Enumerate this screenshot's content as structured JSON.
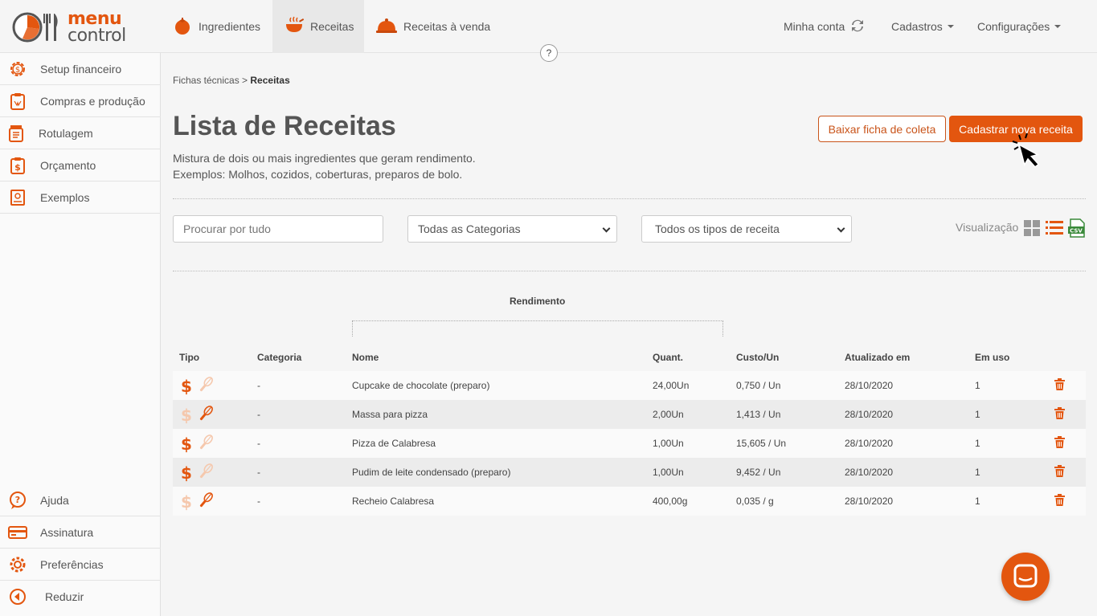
{
  "app": {
    "logo_line1": "menu",
    "logo_line2": "control"
  },
  "colors": {
    "accent": "#e3560f",
    "accent_light": "#f5c8ad",
    "text": "#444444"
  },
  "topnav": {
    "items": [
      {
        "label": "Ingredientes",
        "icon": "tomato-icon"
      },
      {
        "label": "Receitas",
        "icon": "steaming-pot-icon",
        "active": true
      },
      {
        "label": "Receitas à venda",
        "icon": "cloche-icon"
      }
    ],
    "right": {
      "account": "Minha conta",
      "cadastros": "Cadastros",
      "config": "Configurações"
    },
    "help": "?"
  },
  "sidebar": {
    "items": [
      {
        "label": "Setup financeiro",
        "icon": "gear-dollar-icon"
      },
      {
        "label": "Compras e produção",
        "icon": "clipboard-icon"
      },
      {
        "label": "Rotulagem",
        "icon": "jar-label-icon"
      },
      {
        "label": "Orçamento",
        "icon": "clipboard-dollar-icon"
      },
      {
        "label": "Exemplos",
        "icon": "book-icon"
      }
    ],
    "bottom": [
      {
        "label": "Ajuda",
        "icon": "question-bubble-icon"
      },
      {
        "label": "Assinatura",
        "icon": "credit-card-icon"
      },
      {
        "label": "Preferências",
        "icon": "gear-icon"
      },
      {
        "label": "Reduzir",
        "icon": "collapse-left-icon"
      }
    ]
  },
  "page": {
    "breadcrumb_parent": "Fichas técnicas",
    "breadcrumb_sep": " > ",
    "breadcrumb_current": "Receitas",
    "title": "Lista de Receitas",
    "desc_line1": "Mistura de dois ou mais ingredientes que geram rendimento.",
    "desc_line2": "Exemplos: Molhos, cozidos, coberturas, preparos de bolo.",
    "btn_download": "Baixar ficha de coleta",
    "btn_new": "Cadastrar nova receita"
  },
  "filters": {
    "search_placeholder": "Procurar por tudo",
    "category_selected": "Todas as Categorias",
    "type_selected": "Todos os tipos de receita",
    "view_label": "Visualização"
  },
  "table": {
    "group_header": "Rendimento",
    "columns": [
      "Tipo",
      "Categoria",
      "Nome",
      "Quant.",
      "Custo/Un",
      "Atualizado em",
      "Em uso"
    ],
    "rows": [
      {
        "dollar_active": true,
        "whisk_active": false,
        "categoria": "-",
        "nome": "Cupcake de chocolate (preparo)",
        "quant": "24,00Un",
        "custo": "0,750 / Un",
        "atualizado": "28/10/2020",
        "uso": "1"
      },
      {
        "dollar_active": false,
        "whisk_active": true,
        "categoria": "-",
        "nome": "Massa para pizza",
        "quant": "2,00Un",
        "custo": "1,413 / Un",
        "atualizado": "28/10/2020",
        "uso": "1"
      },
      {
        "dollar_active": true,
        "whisk_active": false,
        "categoria": "-",
        "nome": "Pizza de Calabresa",
        "quant": "1,00Un",
        "custo": "15,605 / Un",
        "atualizado": "28/10/2020",
        "uso": "1"
      },
      {
        "dollar_active": true,
        "whisk_active": false,
        "categoria": "-",
        "nome": "Pudim de leite condensado (preparo)",
        "quant": "1,00Un",
        "custo": "9,452 / Un",
        "atualizado": "28/10/2020",
        "uso": "1"
      },
      {
        "dollar_active": false,
        "whisk_active": true,
        "categoria": "-",
        "nome": "Recheio Calabresa",
        "quant": "400,00g",
        "custo": "0,035 / g",
        "atualizado": "28/10/2020",
        "uso": "1"
      }
    ]
  },
  "dollar_symbol": "$"
}
